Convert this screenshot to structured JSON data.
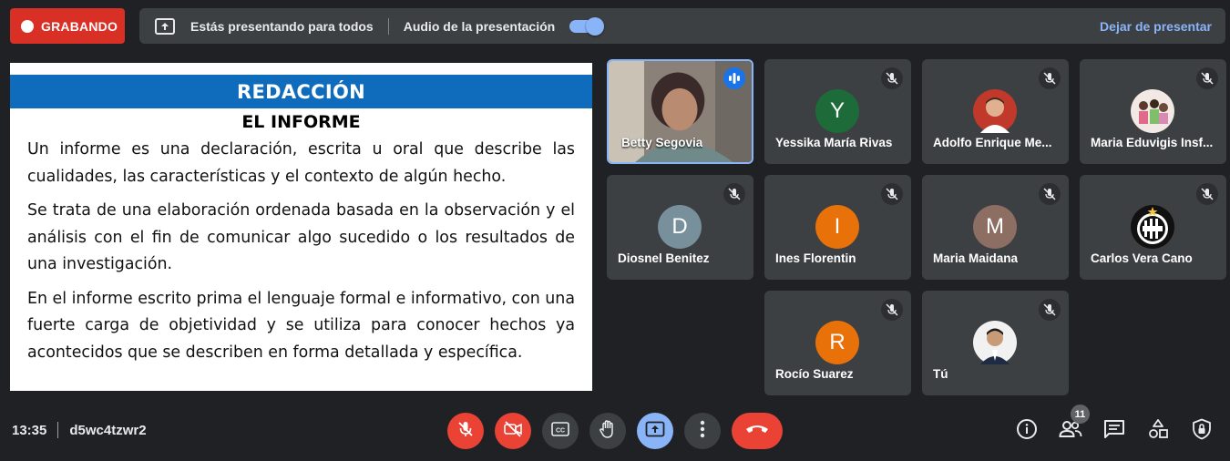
{
  "recording": {
    "label": "GRABANDO"
  },
  "presenting": {
    "status_text": "Estás presentando para todos",
    "audio_label": "Audio de la presentación",
    "audio_enabled": true,
    "stop_label": "Dejar de presentar"
  },
  "slide": {
    "title": "REDACCIÓN",
    "subtitle": "EL INFORME",
    "paragraphs": [
      "Un informe es una declaración, escrita u oral que describe las cualidades, las características y el contexto de algún hecho.",
      "Se trata de una elaboración ordenada basada en la observación y el análisis con el fin de comunicar algo sucedido o los resultados de una investigación.",
      "En el informe escrito prima el lenguaje formal e informativo, con una fuerte carga de objetividad y se utiliza para conocer hechos ya acontecidos que se describen en forma detallada y específica."
    ]
  },
  "participants": [
    {
      "name": "Betty Segovia",
      "video": true,
      "speaking": true
    },
    {
      "name": "Yessika María Rivas",
      "initial": "Y",
      "avatar_color": "#1e6b3a",
      "muted": true
    },
    {
      "name": "Adolfo Enrique Me...",
      "photo": true,
      "muted": true
    },
    {
      "name": "Maria Eduvigis Insf...",
      "photo": true,
      "muted": true
    },
    {
      "name": "Diosnel Benitez",
      "initial": "D",
      "avatar_color": "#78909c",
      "muted": true
    },
    {
      "name": "Ines Florentin",
      "initial": "I",
      "avatar_color": "#e8710a",
      "muted": true
    },
    {
      "name": "Maria Maidana",
      "initial": "M",
      "avatar_color": "#8d6e63",
      "muted": true
    },
    {
      "name": "Carlos Vera Cano",
      "photo": true,
      "muted": true
    },
    {
      "name": "Rocío Suarez",
      "initial": "R",
      "avatar_color": "#e8710a",
      "muted": true
    },
    {
      "name": "Tú",
      "photo": true,
      "muted": true
    }
  ],
  "meeting": {
    "time": "13:35",
    "code": "d5wc4tzwr2"
  },
  "people_count": "11",
  "colors": {
    "accent": "#8ab4f8",
    "danger": "#ea4335",
    "surface": "#3c4043",
    "background": "#202124",
    "slide_banner": "#0f6cbd"
  },
  "icons": {
    "controls": [
      "mic-off-icon",
      "camera-off-icon",
      "captions-icon",
      "raise-hand-icon",
      "present-icon",
      "more-options-icon",
      "end-call-icon"
    ],
    "panel": [
      "info-icon",
      "people-icon",
      "chat-icon",
      "activities-icon",
      "host-controls-icon"
    ]
  }
}
